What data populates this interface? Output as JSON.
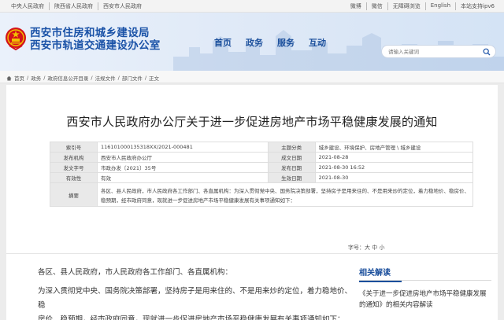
{
  "topbar": {
    "left_links": [
      "中央人民政府",
      "陕西省人民政府",
      "西安市人民政府"
    ],
    "right_links": [
      "微博",
      "微信",
      "无障碍浏览",
      "English",
      "本站支持ipv6"
    ]
  },
  "header": {
    "title_line1": "西安市住房和城乡建设局",
    "title_line2": "西安市轨道交通建设办公室",
    "nav": [
      "首页",
      "政务",
      "服务",
      "互动"
    ],
    "search_placeholder": "请输入关键词"
  },
  "breadcrumb": [
    "首页",
    "政务",
    "政府信息公开目录",
    "法规文件",
    "部门文件",
    "正文"
  ],
  "article": {
    "title": "西安市人民政府办公厅关于进一步促进房地产市场平稳健康发展的通知",
    "meta": {
      "index_label": "索引号",
      "index_value": "116101000135318XX/2021-000481",
      "theme_label": "主题分类",
      "theme_value": "城乡建设、环境保护、房地产管理 \\ 城乡建设",
      "issuer_label": "发布机构",
      "issuer_value": "西安市人民政府办公厅",
      "created_label": "成文日期",
      "created_value": "2021-08-28",
      "docno_label": "发文字号",
      "docno_value": "市政办发〔2021〕35号",
      "published_label": "发布日期",
      "published_value": "2021-08-30 16:52",
      "validity_label": "有效性",
      "validity_value": "有效",
      "effective_label": "生效日期",
      "effective_value": "2021-08-30",
      "abstract_label": "摘要",
      "abstract_value": "各区、县人民政府，市人民政府各工作部门、各直属机构：为深入贯彻党中央、国务院决策部署，坚持房子是用来住的、不是用来炒的定位，着力稳地价、稳房价、稳预期，经市政府同意，现就进一步促进房地产市场平稳健康发展有关事项通知如下："
    },
    "font_size_label": "字号：大 中 小",
    "greeting": "各区、县人民政府，市人民政府各工作部门、各直属机构：",
    "para1_line1": "为深入贯彻党中央、国务院决策部署，坚持房子是用来住的、不是用来炒的定位，着力稳地价、稳",
    "para1_line2": "房价、稳预期，经市政府同意，现就进一步促进房地产市场平稳健康发展有关事项通知如下："
  },
  "related": {
    "heading": "相关解读",
    "text": "《关于进一步促进房地产市场平稳健康发展的通知》的相关内容解读"
  },
  "colors": {
    "brand_blue": "#1a52a7",
    "emblem_red": "#d4141a",
    "emblem_gold": "#f2c200"
  }
}
